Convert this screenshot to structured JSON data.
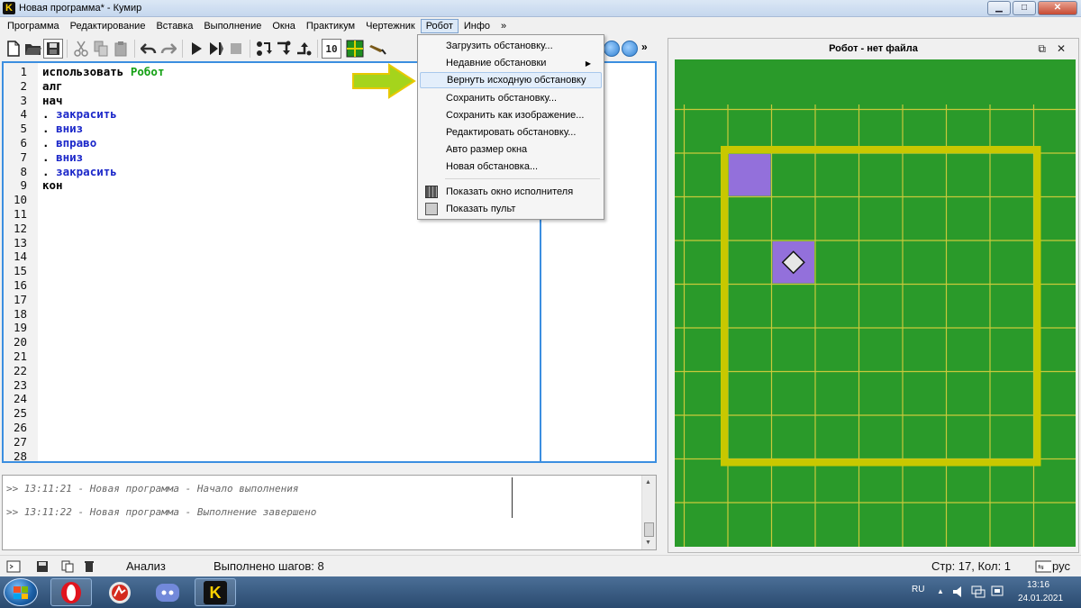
{
  "window": {
    "icon_letter": "K",
    "title": "Новая программа* - Кумир",
    "minimize_glyph": "▁",
    "maximize_glyph": "□",
    "close_glyph": "✕"
  },
  "menubar": {
    "items": [
      "Программа",
      "Редактирование",
      "Вставка",
      "Выполнение",
      "Окна",
      "Практикум",
      "Чертежник",
      "Робот",
      "Инфо",
      "»"
    ],
    "active_index": 7
  },
  "toolbar": {
    "more_glyph": "»",
    "counter_glyph": "10"
  },
  "editor": {
    "line_numbers": [
      "1",
      "2",
      "3",
      "4",
      "5",
      "6",
      "7",
      "8",
      "9",
      "10",
      "11",
      "12",
      "13",
      "14",
      "15",
      "16",
      "17",
      "18",
      "19",
      "20",
      "21",
      "22",
      "23",
      "24",
      "25",
      "26",
      "27",
      "28"
    ],
    "lines": [
      {
        "prefix": "использовать ",
        "value": "Робот",
        "kind": "mod"
      },
      {
        "prefix": "алг",
        "value": "",
        "kind": "kw"
      },
      {
        "prefix": "нач",
        "value": "",
        "kind": "kw"
      },
      {
        "prefix": ". ",
        "value": "закрасить",
        "kind": "cmd"
      },
      {
        "prefix": ". ",
        "value": "вниз",
        "kind": "cmd"
      },
      {
        "prefix": ". ",
        "value": "вправо",
        "kind": "cmd"
      },
      {
        "prefix": ". ",
        "value": "вниз",
        "kind": "cmd"
      },
      {
        "prefix": ". ",
        "value": "закрасить",
        "kind": "cmd"
      },
      {
        "prefix": "кон",
        "value": "",
        "kind": "kw"
      }
    ]
  },
  "robot_menu": {
    "items": [
      {
        "label": "Загрузить обстановку...",
        "submenu": false,
        "highlighted": false,
        "icon": ""
      },
      {
        "label": "Недавние обстановки",
        "submenu": true,
        "highlighted": false,
        "icon": ""
      },
      {
        "label": "Вернуть исходную обстановку",
        "submenu": false,
        "highlighted": true,
        "icon": ""
      },
      {
        "label": "Сохранить обстановку...",
        "submenu": false,
        "highlighted": false,
        "icon": ""
      },
      {
        "label": "Сохранить как изображение...",
        "submenu": false,
        "highlighted": false,
        "icon": ""
      },
      {
        "label": "Редактировать обстановку...",
        "submenu": false,
        "highlighted": false,
        "icon": ""
      },
      {
        "label": "Авто размер окна",
        "submenu": false,
        "highlighted": false,
        "icon": ""
      },
      {
        "label": "Новая обстановка...",
        "submenu": false,
        "highlighted": false,
        "icon": ""
      },
      {
        "label": "Показать окно исполнителя",
        "submenu": false,
        "highlighted": false,
        "icon": "grid-icon"
      },
      {
        "label": "Показать пульт",
        "submenu": false,
        "highlighted": false,
        "icon": "remote-icon"
      }
    ],
    "submenu_glyph": "▶"
  },
  "output": {
    "lines": [
      ">> 13:11:21 - Новая программа - Начало выполнения",
      ">> 13:11:22 - Новая программа - Выполнение завершено"
    ]
  },
  "robot_panel": {
    "title": "Робот - нет файла",
    "float_glyph": "⧉",
    "close_glyph": "✕",
    "field": {
      "field_color": "#2a9a2a",
      "grid_color": "#c9c93a",
      "wall_color": "#c8c800",
      "painted_color": "#9370db",
      "robot_color": "#e6e6e6",
      "painted_cells": [
        [
          0,
          0
        ],
        [
          1,
          2
        ]
      ],
      "robot_cell": [
        1,
        2
      ]
    }
  },
  "statusbar": {
    "analysis": "Анализ",
    "steps": "Выполнено шагов: 8",
    "position": "Стр: 17, Кол: 1",
    "lang": "рус"
  },
  "taskbar": {
    "kumir_letter": "K",
    "lang": "RU",
    "time": "13:16",
    "date": "24.01.2021"
  },
  "colors": {
    "accent_blue": "#3b8ee0",
    "arrow_yellow": "#a5d41c",
    "command_blue": "#1b27c9",
    "module_green": "#14a014"
  }
}
